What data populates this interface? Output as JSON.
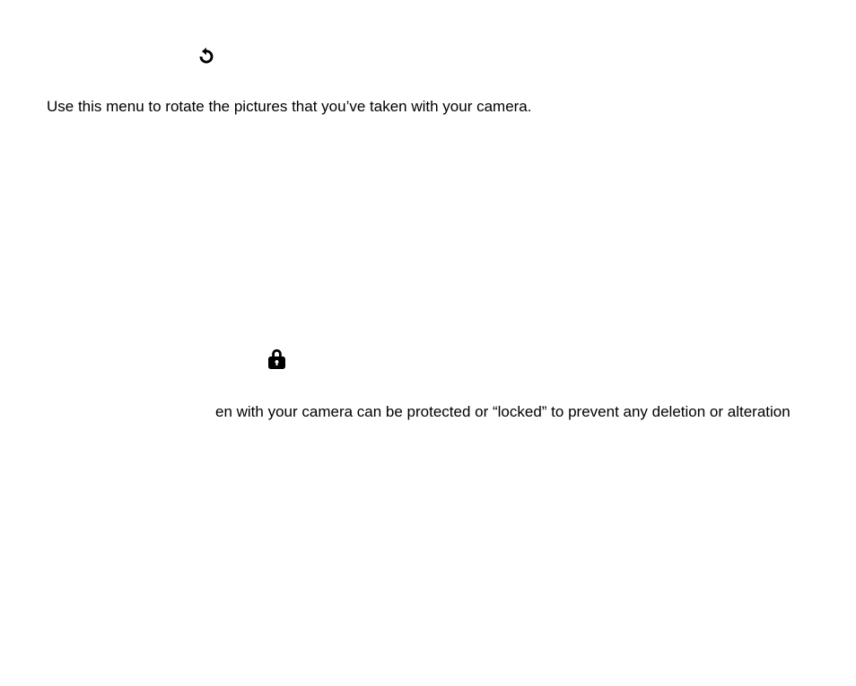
{
  "section1": {
    "text": "Use this menu to rotate the pictures that you’ve taken with your camera."
  },
  "section2": {
    "text": "en with your camera can be protected or “locked” to prevent any deletion or alteration"
  }
}
